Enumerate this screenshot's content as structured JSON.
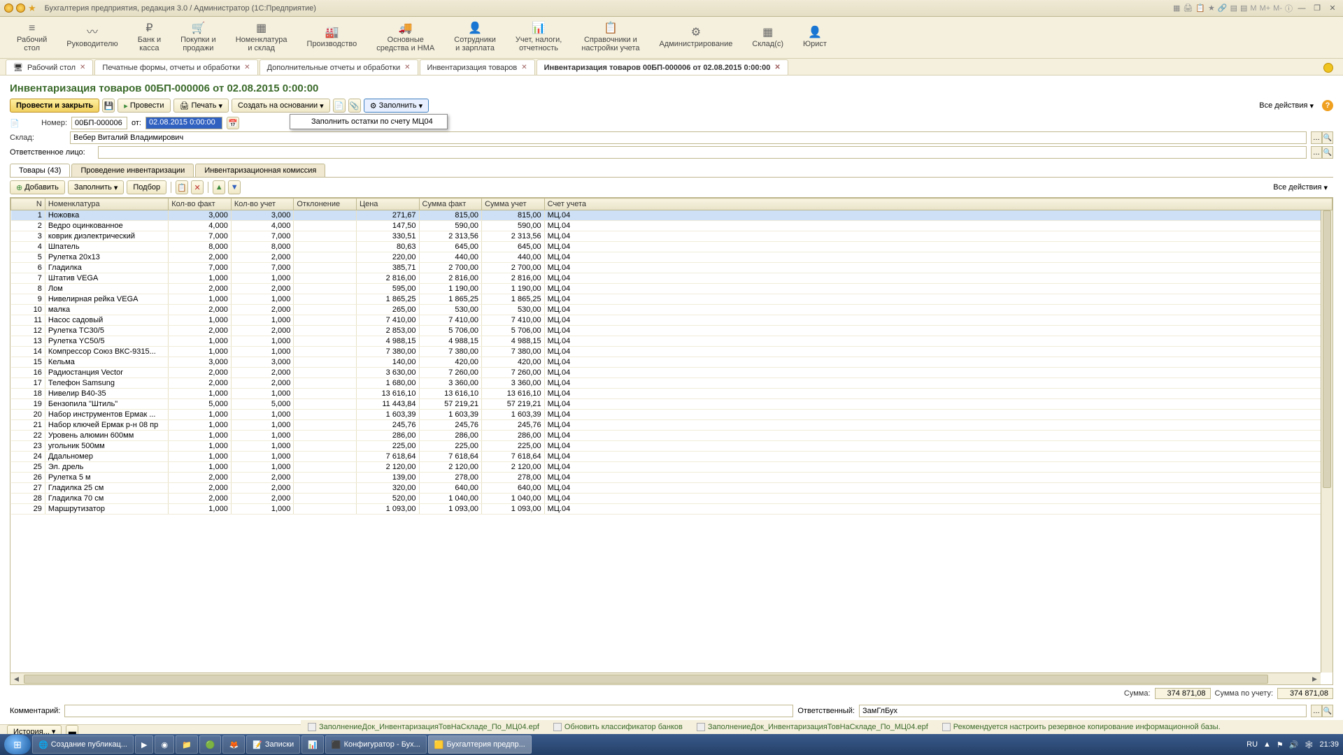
{
  "titlebar": {
    "text": "Бухгалтерия предприятия, редакция 3.0 / Администратор  (1С:Предприятие)",
    "m_labels": [
      "M",
      "M+",
      "M-"
    ]
  },
  "sections": [
    {
      "icon": "≡",
      "label": "Рабочий\nстол"
    },
    {
      "icon": "〰",
      "label": "Руководителю"
    },
    {
      "icon": "₽",
      "label": "Банк и\nкасса"
    },
    {
      "icon": "🛒",
      "label": "Покупки и\nпродажи"
    },
    {
      "icon": "▦",
      "label": "Номенклатура\nи склад"
    },
    {
      "icon": "🏭",
      "label": "Производство"
    },
    {
      "icon": "🚚",
      "label": "Основные\nсредства и НМА"
    },
    {
      "icon": "👤",
      "label": "Сотрудники\nи зарплата"
    },
    {
      "icon": "📊",
      "label": "Учет, налоги,\nотчетность"
    },
    {
      "icon": "📋",
      "label": "Справочники и\nнастройки учета"
    },
    {
      "icon": "⚙",
      "label": "Администрирование"
    },
    {
      "icon": "▦",
      "label": "Склад(с)"
    },
    {
      "icon": "👤",
      "label": "Юрист"
    }
  ],
  "tabs": [
    {
      "label": "Рабочий стол",
      "closable": true,
      "icon": "🖥"
    },
    {
      "label": "Печатные формы, отчеты и обработки",
      "closable": true
    },
    {
      "label": "Дополнительные отчеты и обработки",
      "closable": true
    },
    {
      "label": "Инвентаризация товаров",
      "closable": true
    },
    {
      "label": "Инвентаризация товаров 00БП-000006 от 02.08.2015 0:00:00",
      "closable": true,
      "active": true
    }
  ],
  "doc": {
    "title": "Инвентаризация товаров 00БП-000006 от 02.08.2015 0:00:00",
    "toolbar": {
      "postClose": "Провести и закрыть",
      "post": "Провести",
      "print": "Печать",
      "createBased": "Создать на основании",
      "fill": "Заполнить",
      "fillMenuItem": "Заполнить остатки по счету МЦ04",
      "allActions": "Все действия"
    },
    "fields": {
      "numberLabel": "Номер:",
      "number": "00БП-000006",
      "fromLabel": "от:",
      "date": "02.08.2015  0:00:00",
      "warehouseLabel": "Склад:",
      "warehouse": "Вебер Виталий Владимирович",
      "respPersonLabel": "Ответственное лицо:",
      "respPerson": ""
    },
    "innerTabs": [
      {
        "label": "Товары (43)",
        "active": true
      },
      {
        "label": "Проведение инвентаризации"
      },
      {
        "label": "Инвентаризационная комиссия"
      }
    ],
    "tblToolbar": {
      "add": "Добавить",
      "fill": "Заполнить",
      "pick": "Подбор",
      "allActions": "Все действия"
    },
    "columns": [
      "N",
      "Номенклатура",
      "Кол-во факт",
      "Кол-во учет",
      "Отклонение",
      "Цена",
      "Сумма факт",
      "Сумма учет",
      "Счет учета"
    ],
    "rows": [
      {
        "n": 1,
        "nom": "Ножовка",
        "qf": "3,000",
        "qa": "3,000",
        "dev": "",
        "price": "271,67",
        "sf": "815,00",
        "sa": "815,00",
        "acc": "МЦ.04"
      },
      {
        "n": 2,
        "nom": "Ведро оцинкованное",
        "qf": "4,000",
        "qa": "4,000",
        "dev": "",
        "price": "147,50",
        "sf": "590,00",
        "sa": "590,00",
        "acc": "МЦ.04"
      },
      {
        "n": 3,
        "nom": "коврик диэлектрический",
        "qf": "7,000",
        "qa": "7,000",
        "dev": "",
        "price": "330,51",
        "sf": "2 313,56",
        "sa": "2 313,56",
        "acc": "МЦ.04"
      },
      {
        "n": 4,
        "nom": "Шпатель",
        "qf": "8,000",
        "qa": "8,000",
        "dev": "",
        "price": "80,63",
        "sf": "645,00",
        "sa": "645,00",
        "acc": "МЦ.04"
      },
      {
        "n": 5,
        "nom": "Рулетка 20х13",
        "qf": "2,000",
        "qa": "2,000",
        "dev": "",
        "price": "220,00",
        "sf": "440,00",
        "sa": "440,00",
        "acc": "МЦ.04"
      },
      {
        "n": 6,
        "nom": "Гладилка",
        "qf": "7,000",
        "qa": "7,000",
        "dev": "",
        "price": "385,71",
        "sf": "2 700,00",
        "sa": "2 700,00",
        "acc": "МЦ.04"
      },
      {
        "n": 7,
        "nom": "Штатив VEGA",
        "qf": "1,000",
        "qa": "1,000",
        "dev": "",
        "price": "2 816,00",
        "sf": "2 816,00",
        "sa": "2 816,00",
        "acc": "МЦ.04"
      },
      {
        "n": 8,
        "nom": "Лом",
        "qf": "2,000",
        "qa": "2,000",
        "dev": "",
        "price": "595,00",
        "sf": "1 190,00",
        "sa": "1 190,00",
        "acc": "МЦ.04"
      },
      {
        "n": 9,
        "nom": "Нивелирная рейка VEGA",
        "qf": "1,000",
        "qa": "1,000",
        "dev": "",
        "price": "1 865,25",
        "sf": "1 865,25",
        "sa": "1 865,25",
        "acc": "МЦ.04"
      },
      {
        "n": 10,
        "nom": "малка",
        "qf": "2,000",
        "qa": "2,000",
        "dev": "",
        "price": "265,00",
        "sf": "530,00",
        "sa": "530,00",
        "acc": "МЦ.04"
      },
      {
        "n": 11,
        "nom": "Насос садовый",
        "qf": "1,000",
        "qa": "1,000",
        "dev": "",
        "price": "7 410,00",
        "sf": "7 410,00",
        "sa": "7 410,00",
        "acc": "МЦ.04"
      },
      {
        "n": 12,
        "nom": "Рулетка TC30/5",
        "qf": "2,000",
        "qa": "2,000",
        "dev": "",
        "price": "2 853,00",
        "sf": "5 706,00",
        "sa": "5 706,00",
        "acc": "МЦ.04"
      },
      {
        "n": 13,
        "nom": "Рулетка YC50/5",
        "qf": "1,000",
        "qa": "1,000",
        "dev": "",
        "price": "4 988,15",
        "sf": "4 988,15",
        "sa": "4 988,15",
        "acc": "МЦ.04"
      },
      {
        "n": 14,
        "nom": "Компрессор Союз ВКС-9315...",
        "qf": "1,000",
        "qa": "1,000",
        "dev": "",
        "price": "7 380,00",
        "sf": "7 380,00",
        "sa": "7 380,00",
        "acc": "МЦ.04"
      },
      {
        "n": 15,
        "nom": "Кельма",
        "qf": "3,000",
        "qa": "3,000",
        "dev": "",
        "price": "140,00",
        "sf": "420,00",
        "sa": "420,00",
        "acc": "МЦ.04"
      },
      {
        "n": 16,
        "nom": "Радиостанция Vector",
        "qf": "2,000",
        "qa": "2,000",
        "dev": "",
        "price": "3 630,00",
        "sf": "7 260,00",
        "sa": "7 260,00",
        "acc": "МЦ.04"
      },
      {
        "n": 17,
        "nom": "Телефон Samsung",
        "qf": "2,000",
        "qa": "2,000",
        "dev": "",
        "price": "1 680,00",
        "sf": "3 360,00",
        "sa": "3 360,00",
        "acc": "МЦ.04"
      },
      {
        "n": 18,
        "nom": "Нивелир B40-35",
        "qf": "1,000",
        "qa": "1,000",
        "dev": "",
        "price": "13 616,10",
        "sf": "13 616,10",
        "sa": "13 616,10",
        "acc": "МЦ.04"
      },
      {
        "n": 19,
        "nom": "Бензопила \"Штиль\"",
        "qf": "5,000",
        "qa": "5,000",
        "dev": "",
        "price": "11 443,84",
        "sf": "57 219,21",
        "sa": "57 219,21",
        "acc": "МЦ.04"
      },
      {
        "n": 20,
        "nom": "Набор инструментов Ермак ...",
        "qf": "1,000",
        "qa": "1,000",
        "dev": "",
        "price": "1 603,39",
        "sf": "1 603,39",
        "sa": "1 603,39",
        "acc": "МЦ.04"
      },
      {
        "n": 21,
        "nom": "Набор ключей Ермак р-н 08 пр",
        "qf": "1,000",
        "qa": "1,000",
        "dev": "",
        "price": "245,76",
        "sf": "245,76",
        "sa": "245,76",
        "acc": "МЦ.04"
      },
      {
        "n": 22,
        "nom": "Уровень алюмин 600мм",
        "qf": "1,000",
        "qa": "1,000",
        "dev": "",
        "price": "286,00",
        "sf": "286,00",
        "sa": "286,00",
        "acc": "МЦ.04"
      },
      {
        "n": 23,
        "nom": "угольник 500мм",
        "qf": "1,000",
        "qa": "1,000",
        "dev": "",
        "price": "225,00",
        "sf": "225,00",
        "sa": "225,00",
        "acc": "МЦ.04"
      },
      {
        "n": 24,
        "nom": "Ддальномер",
        "qf": "1,000",
        "qa": "1,000",
        "dev": "",
        "price": "7 618,64",
        "sf": "7 618,64",
        "sa": "7 618,64",
        "acc": "МЦ.04"
      },
      {
        "n": 25,
        "nom": "Эл. дрель",
        "qf": "1,000",
        "qa": "1,000",
        "dev": "",
        "price": "2 120,00",
        "sf": "2 120,00",
        "sa": "2 120,00",
        "acc": "МЦ.04"
      },
      {
        "n": 26,
        "nom": "Рулетка 5 м",
        "qf": "2,000",
        "qa": "2,000",
        "dev": "",
        "price": "139,00",
        "sf": "278,00",
        "sa": "278,00",
        "acc": "МЦ.04"
      },
      {
        "n": 27,
        "nom": "Гладилка 25 см",
        "qf": "2,000",
        "qa": "2,000",
        "dev": "",
        "price": "320,00",
        "sf": "640,00",
        "sa": "640,00",
        "acc": "МЦ.04"
      },
      {
        "n": 28,
        "nom": "Гладилка 70 см",
        "qf": "2,000",
        "qa": "2,000",
        "dev": "",
        "price": "520,00",
        "sf": "1 040,00",
        "sa": "1 040,00",
        "acc": "МЦ.04"
      },
      {
        "n": 29,
        "nom": "Маршрутизатор",
        "qf": "1,000",
        "qa": "1,000",
        "dev": "",
        "price": "1 093,00",
        "sf": "1 093,00",
        "sa": "1 093,00",
        "acc": "МЦ.04"
      }
    ],
    "sums": {
      "sumLabel": "Сумма:",
      "sum": "374 871,08",
      "sumAccLabel": "Сумма по учету:",
      "sumAcc": "374 871,08"
    },
    "bottom": {
      "commentLabel": "Комментарий:",
      "comment": "",
      "responsibleLabel": "Ответственный:",
      "responsible": "ЗамГлБух"
    }
  },
  "history": {
    "label": "История..."
  },
  "infoBar": [
    "ЗаполнениеДок_ИнвентаризацияТовНаСкладе_По_МЦ04.epf",
    "Обновить классификатор банков",
    "ЗаполнениеДок_ИнвентаризацияТовНаСкладе_По_МЦ04.epf",
    "Рекомендуется настроить резервное копирование информационной базы."
  ],
  "taskbar": {
    "items": [
      {
        "label": "Создание публикац...",
        "icon": "🌐"
      },
      {
        "label": "",
        "icon": "▶"
      },
      {
        "label": "",
        "icon": "◉"
      },
      {
        "label": "",
        "icon": "📁"
      },
      {
        "label": "",
        "icon": "🟢"
      },
      {
        "label": "",
        "icon": "🦊"
      },
      {
        "label": "Записки",
        "icon": "📝"
      },
      {
        "label": "",
        "icon": "📊"
      },
      {
        "label": "Конфигуратор - Бух...",
        "icon": "⬛"
      },
      {
        "label": "Бухгалтерия предпр...",
        "icon": "🟨",
        "active": true
      }
    ],
    "lang": "RU",
    "time": "21:39"
  }
}
